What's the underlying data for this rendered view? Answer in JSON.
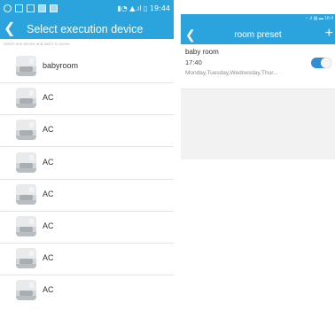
{
  "left": {
    "status_bar": {
      "time": "19:44"
    },
    "title": "Select execution device",
    "subtitle": "Select one device and add it to scene",
    "items": [
      {
        "label": "babyroom"
      },
      {
        "label": "AC"
      },
      {
        "label": "AC"
      },
      {
        "label": "AC"
      },
      {
        "label": "AC"
      },
      {
        "label": "AC"
      },
      {
        "label": "AC"
      },
      {
        "label": "AC"
      }
    ]
  },
  "right": {
    "status_bar": {
      "time": "16:4"
    },
    "title": "room preset",
    "add_label": "+",
    "preset": {
      "name": "baby room",
      "time": "17:40",
      "days": "Monday,Tuesday,Wednesday,Thur...",
      "enabled": true
    }
  },
  "colors": {
    "accent": "#2ba4de",
    "toggle_on": "#2e8fd2"
  },
  "icons": {
    "back": "chevron-left-icon",
    "add": "plus-icon"
  }
}
